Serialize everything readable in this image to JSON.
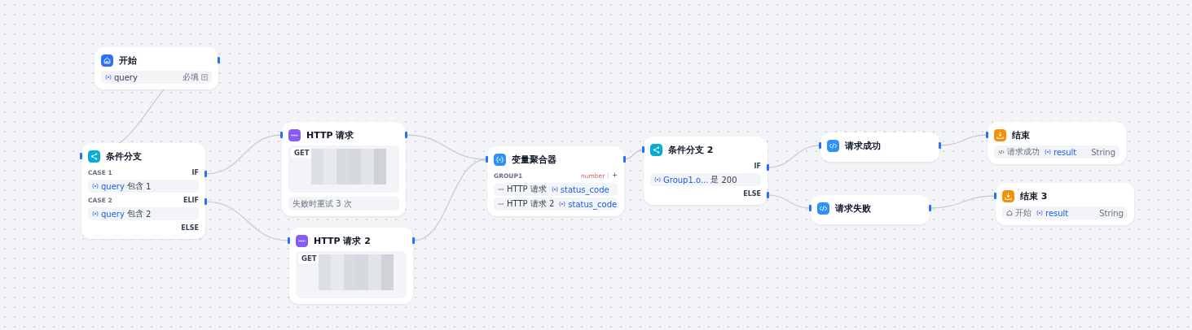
{
  "nodes": [
    {
      "kind": "start",
      "title": "开始",
      "vars": [
        {
          "name": "query",
          "required": "必填"
        }
      ]
    },
    {
      "kind": "if",
      "title": "条件分支",
      "cases": [
        {
          "label": "CASE 1",
          "branch": "IF",
          "var": "query",
          "op": "包含",
          "value": "1"
        },
        {
          "label": "CASE 2",
          "branch": "ELIF",
          "var": "query",
          "op": "包含",
          "value": "2"
        }
      ],
      "else": "ELSE"
    },
    {
      "kind": "http",
      "title": "HTTP 请求",
      "method": "GET",
      "retry": "失败时重试 3 次"
    },
    {
      "kind": "http",
      "title": "HTTP 请求 2",
      "method": "GET"
    },
    {
      "kind": "aggregator",
      "title": "变量聚合器",
      "group": "GROUP1",
      "type": "number",
      "add": "+",
      "items": [
        {
          "node": "HTTP 请求",
          "var": "status_code"
        },
        {
          "node": "HTTP 请求 2",
          "var": "status_code"
        }
      ]
    },
    {
      "kind": "if",
      "title": "条件分支 2",
      "cases": [
        {
          "branch": "IF",
          "var": "Group1.o...",
          "op": "是",
          "value": "200"
        }
      ],
      "else": "ELSE"
    },
    {
      "kind": "code",
      "title": "请求成功"
    },
    {
      "kind": "code",
      "title": "请求失败"
    },
    {
      "kind": "end",
      "title": "结束",
      "outputs": [
        {
          "node": "请求成功",
          "kind": "code",
          "var": "result",
          "type": "String"
        }
      ]
    },
    {
      "kind": "end",
      "title": "结束 3",
      "outputs": [
        {
          "node": "开始",
          "kind": "start",
          "var": "result",
          "type": "String"
        }
      ]
    }
  ]
}
